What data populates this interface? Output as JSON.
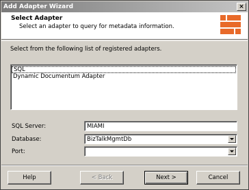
{
  "window": {
    "title": "Add Adapter Wizard",
    "close_glyph": "×"
  },
  "header": {
    "title": "Select Adapter",
    "description": "Select an adapter to query for metadata information."
  },
  "intro": "Select from the following list of registered adapters.",
  "adapters": {
    "items": [
      "SQL",
      "Dynamic Documentum Adapter"
    ],
    "selected": "SQL"
  },
  "form": {
    "sql_server": {
      "label": "SQL Server:",
      "value": "MIAMI"
    },
    "database": {
      "label": "Database:",
      "value": "BizTalkMgmtDb"
    },
    "port": {
      "label": "Port:",
      "value": ""
    }
  },
  "buttons": {
    "help": "Help",
    "back": "< Back",
    "next": "Next >",
    "cancel": "Cancel"
  },
  "colors": {
    "logo_accent": "#e86a2a",
    "title_bar_start": "#7a7a7a"
  }
}
